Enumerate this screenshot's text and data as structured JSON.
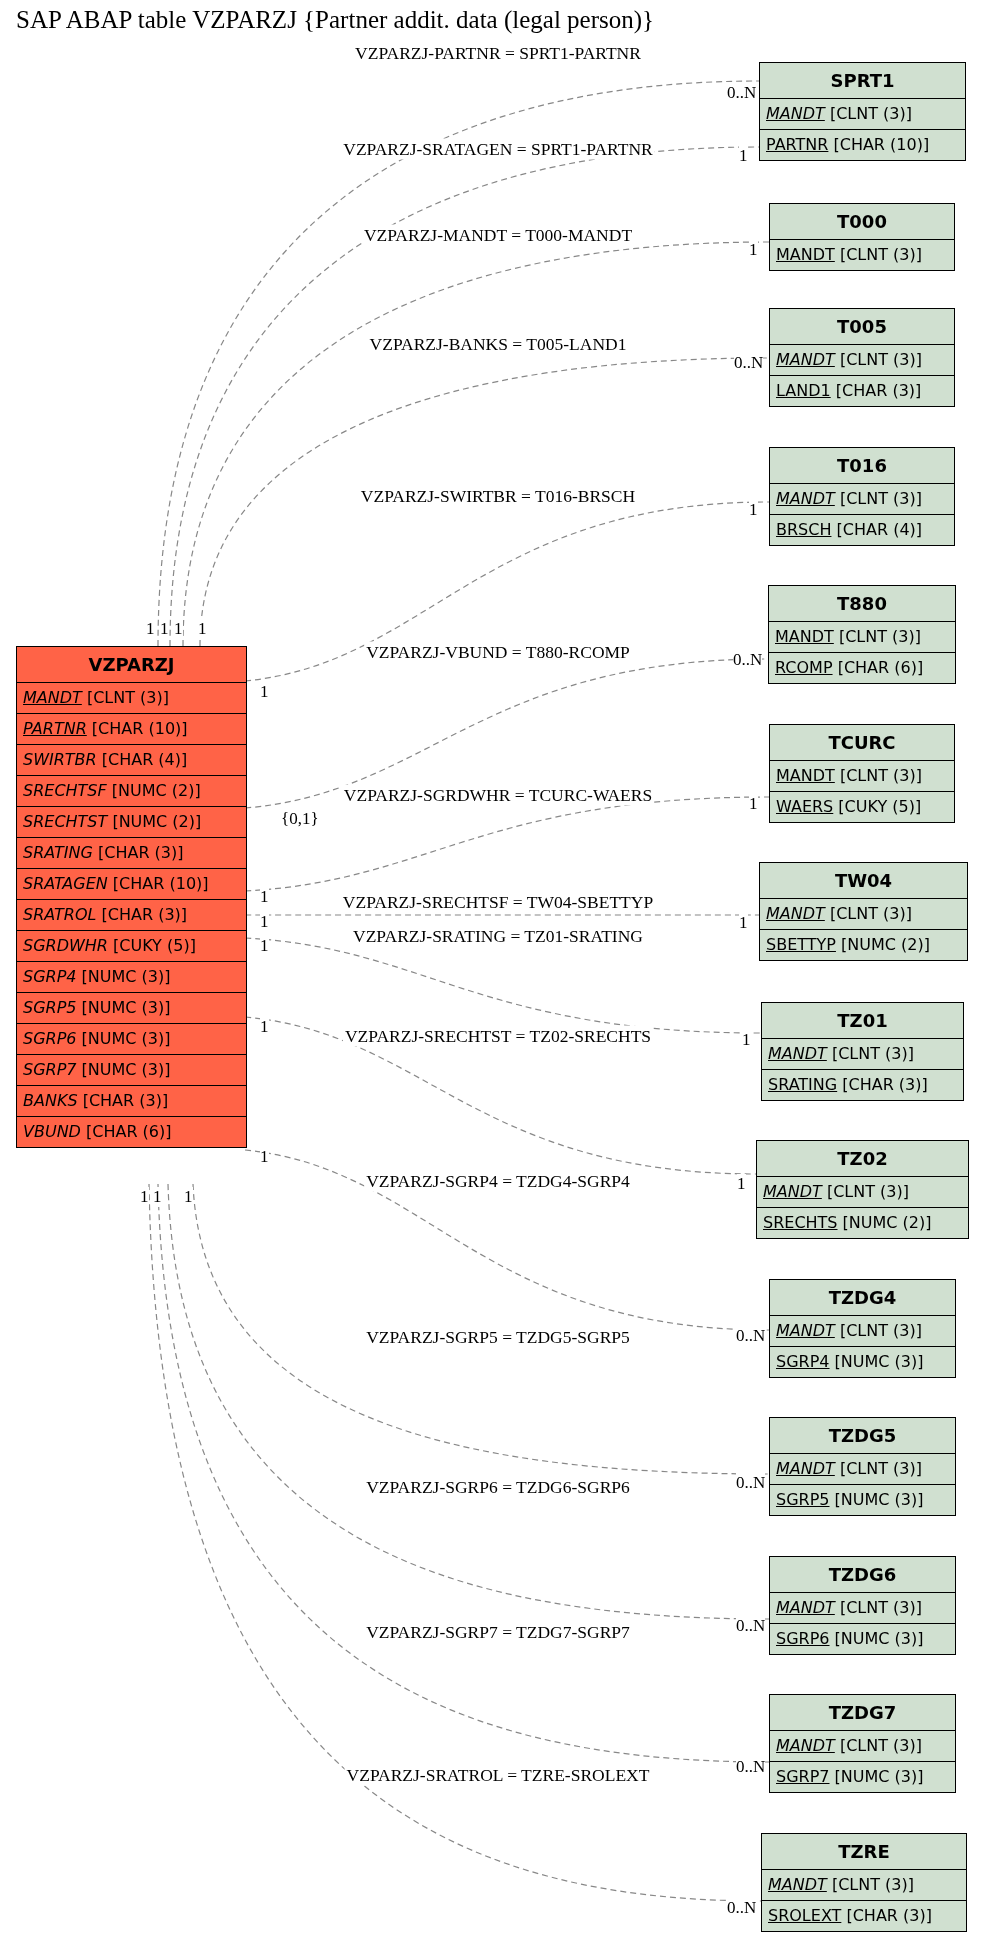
{
  "title": "SAP ABAP table VZPARZJ {Partner addit. data (legal person)}",
  "main_table": {
    "name": "VZPARZJ",
    "fields": [
      {
        "name": "MANDT",
        "type": "[CLNT (3)]",
        "key": true,
        "italic": true
      },
      {
        "name": "PARTNR",
        "type": "[CHAR (10)]",
        "key": true,
        "italic": true
      },
      {
        "name": "SWIRTBR",
        "type": "[CHAR (4)]",
        "key": false,
        "italic": true
      },
      {
        "name": "SRECHTSF",
        "type": "[NUMC (2)]",
        "key": false,
        "italic": true
      },
      {
        "name": "SRECHTST",
        "type": "[NUMC (2)]",
        "key": false,
        "italic": true
      },
      {
        "name": "SRATING",
        "type": "[CHAR (3)]",
        "key": false,
        "italic": true
      },
      {
        "name": "SRATAGEN",
        "type": "[CHAR (10)]",
        "key": false,
        "italic": true
      },
      {
        "name": "SRATROL",
        "type": "[CHAR (3)]",
        "key": false,
        "italic": true
      },
      {
        "name": "SGRDWHR",
        "type": "[CUKY (5)]",
        "key": false,
        "italic": true
      },
      {
        "name": "SGRP4",
        "type": "[NUMC (3)]",
        "key": false,
        "italic": true
      },
      {
        "name": "SGRP5",
        "type": "[NUMC (3)]",
        "key": false,
        "italic": true
      },
      {
        "name": "SGRP6",
        "type": "[NUMC (3)]",
        "key": false,
        "italic": true
      },
      {
        "name": "SGRP7",
        "type": "[NUMC (3)]",
        "key": false,
        "italic": true
      },
      {
        "name": "BANKS",
        "type": "[CHAR (3)]",
        "key": false,
        "italic": true
      },
      {
        "name": "VBUND",
        "type": "[CHAR (6)]",
        "key": false,
        "italic": true
      }
    ]
  },
  "tables": [
    {
      "name": "SPRT1",
      "fields": [
        {
          "name": "MANDT",
          "type": "[CLNT (3)]",
          "key": true,
          "italic": true
        },
        {
          "name": "PARTNR",
          "type": "[CHAR (10)]",
          "key": true,
          "italic": false
        }
      ]
    },
    {
      "name": "T000",
      "fields": [
        {
          "name": "MANDT",
          "type": "[CLNT (3)]",
          "key": true,
          "italic": false
        }
      ]
    },
    {
      "name": "T005",
      "fields": [
        {
          "name": "MANDT",
          "type": "[CLNT (3)]",
          "key": true,
          "italic": true
        },
        {
          "name": "LAND1",
          "type": "[CHAR (3)]",
          "key": true,
          "italic": false
        }
      ]
    },
    {
      "name": "T016",
      "fields": [
        {
          "name": "MANDT",
          "type": "[CLNT (3)]",
          "key": true,
          "italic": true
        },
        {
          "name": "BRSCH",
          "type": "[CHAR (4)]",
          "key": true,
          "italic": false
        }
      ]
    },
    {
      "name": "T880",
      "fields": [
        {
          "name": "MANDT",
          "type": "[CLNT (3)]",
          "key": true,
          "italic": false
        },
        {
          "name": "RCOMP",
          "type": "[CHAR (6)]",
          "key": true,
          "italic": false
        }
      ]
    },
    {
      "name": "TCURC",
      "fields": [
        {
          "name": "MANDT",
          "type": "[CLNT (3)]",
          "key": true,
          "italic": false
        },
        {
          "name": "WAERS",
          "type": "[CUKY (5)]",
          "key": true,
          "italic": false
        }
      ]
    },
    {
      "name": "TW04",
      "fields": [
        {
          "name": "MANDT",
          "type": "[CLNT (3)]",
          "key": true,
          "italic": true
        },
        {
          "name": "SBETTYP",
          "type": "[NUMC (2)]",
          "key": true,
          "italic": false
        }
      ]
    },
    {
      "name": "TZ01",
      "fields": [
        {
          "name": "MANDT",
          "type": "[CLNT (3)]",
          "key": true,
          "italic": true
        },
        {
          "name": "SRATING",
          "type": "[CHAR (3)]",
          "key": true,
          "italic": false
        }
      ]
    },
    {
      "name": "TZ02",
      "fields": [
        {
          "name": "MANDT",
          "type": "[CLNT (3)]",
          "key": true,
          "italic": true
        },
        {
          "name": "SRECHTS",
          "type": "[NUMC (2)]",
          "key": true,
          "italic": false
        }
      ]
    },
    {
      "name": "TZDG4",
      "fields": [
        {
          "name": "MANDT",
          "type": "[CLNT (3)]",
          "key": true,
          "italic": true
        },
        {
          "name": "SGRP4",
          "type": "[NUMC (3)]",
          "key": true,
          "italic": false
        }
      ]
    },
    {
      "name": "TZDG5",
      "fields": [
        {
          "name": "MANDT",
          "type": "[CLNT (3)]",
          "key": true,
          "italic": true
        },
        {
          "name": "SGRP5",
          "type": "[NUMC (3)]",
          "key": true,
          "italic": false
        }
      ]
    },
    {
      "name": "TZDG6",
      "fields": [
        {
          "name": "MANDT",
          "type": "[CLNT (3)]",
          "key": true,
          "italic": true
        },
        {
          "name": "SGRP6",
          "type": "[NUMC (3)]",
          "key": true,
          "italic": false
        }
      ]
    },
    {
      "name": "TZDG7",
      "fields": [
        {
          "name": "MANDT",
          "type": "[CLNT (3)]",
          "key": true,
          "italic": true
        },
        {
          "name": "SGRP7",
          "type": "[NUMC (3)]",
          "key": true,
          "italic": false
        }
      ]
    },
    {
      "name": "TZRE",
      "fields": [
        {
          "name": "MANDT",
          "type": "[CLNT (3)]",
          "key": true,
          "italic": true
        },
        {
          "name": "SROLEXT",
          "type": "[CHAR (3)]",
          "key": true,
          "italic": false
        }
      ]
    }
  ],
  "relationships": [
    {
      "label": "VZPARZJ-PARTNR = SPRT1-PARTNR",
      "from_card": "1",
      "to_card": "0..N"
    },
    {
      "label": "VZPARZJ-SRATAGEN = SPRT1-PARTNR",
      "from_card": "1",
      "to_card": "1"
    },
    {
      "label": "VZPARZJ-MANDT = T000-MANDT",
      "from_card": "1",
      "to_card": "1"
    },
    {
      "label": "VZPARZJ-BANKS = T005-LAND1",
      "from_card": "1",
      "to_card": "0..N"
    },
    {
      "label": "VZPARZJ-SWIRTBR = T016-BRSCH",
      "from_card": "1",
      "to_card": "1"
    },
    {
      "label": "VZPARZJ-VBUND = T880-RCOMP",
      "from_card": "{0,1}",
      "to_card": "0..N"
    },
    {
      "label": "VZPARZJ-SGRDWHR = TCURC-WAERS",
      "from_card": "1",
      "to_card": "1"
    },
    {
      "label": "VZPARZJ-SRECHTSF = TW04-SBETTYP",
      "from_card": "1",
      "to_card": "1"
    },
    {
      "label": "VZPARZJ-SRATING = TZ01-SRATING",
      "from_card": "1",
      "to_card": "1"
    },
    {
      "label": "VZPARZJ-SRECHTST = TZ02-SRECHTS",
      "from_card": "1",
      "to_card": "1"
    },
    {
      "label": "VZPARZJ-SGRP4 = TZDG4-SGRP4",
      "from_card": "1",
      "to_card": "0..N"
    },
    {
      "label": "VZPARZJ-SGRP5 = TZDG5-SGRP5",
      "from_card": "1",
      "to_card": "0..N"
    },
    {
      "label": "VZPARZJ-SGRP6 = TZDG6-SGRP6",
      "from_card": "1",
      "to_card": "0..N"
    },
    {
      "label": "VZPARZJ-SGRP7 = TZDG7-SGRP7",
      "from_card": "1",
      "to_card": "0..N"
    },
    {
      "label": "VZPARZJ-SRATROL = TZRE-SROLEXT",
      "to_card": "0..N"
    }
  ]
}
